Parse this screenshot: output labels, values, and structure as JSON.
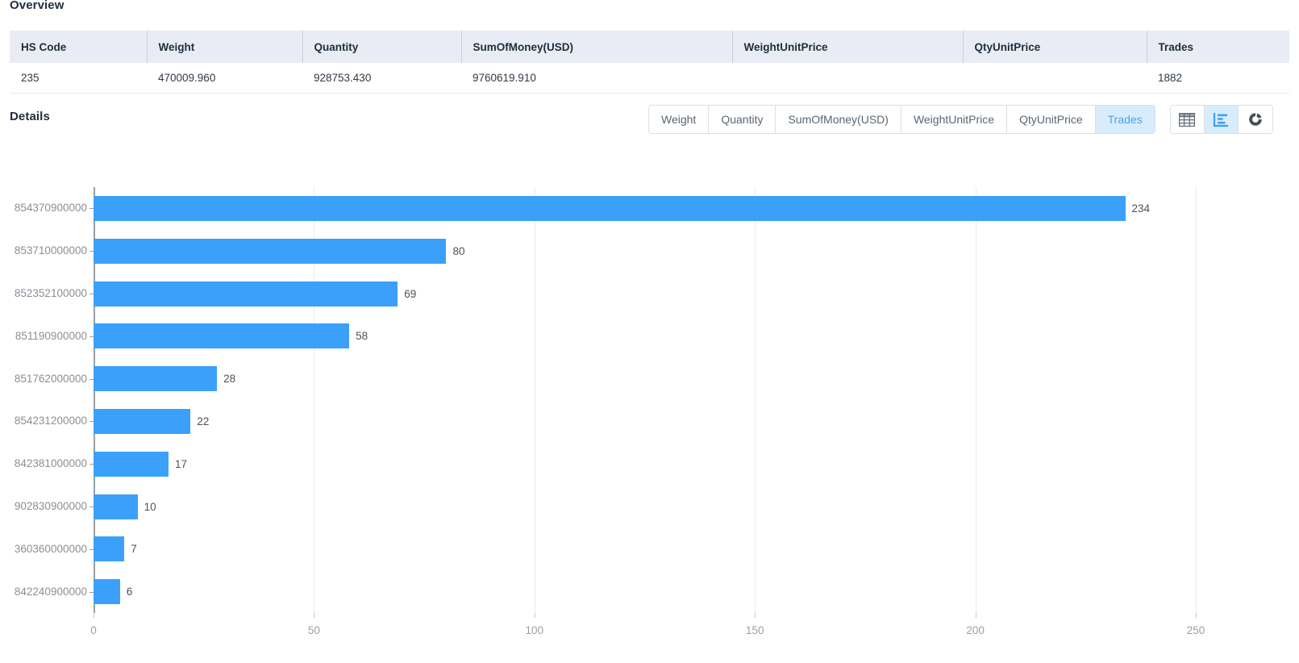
{
  "overview": {
    "title": "Overview",
    "columns": [
      {
        "key": "hs_code",
        "label": "HS Code"
      },
      {
        "key": "weight",
        "label": "Weight"
      },
      {
        "key": "quantity",
        "label": "Quantity"
      },
      {
        "key": "sum_of_money",
        "label": "SumOfMoney(USD)"
      },
      {
        "key": "weight_unit_price",
        "label": "WeightUnitPrice"
      },
      {
        "key": "qty_unit_price",
        "label": "QtyUnitPrice"
      },
      {
        "key": "trades",
        "label": "Trades"
      }
    ],
    "row": {
      "hs_code": "235",
      "weight": "470009.960",
      "quantity": "928753.430",
      "sum_of_money": "9760619.910",
      "weight_unit_price": "",
      "qty_unit_price": "",
      "trades": "1882"
    }
  },
  "details": {
    "title": "Details",
    "tabs": [
      {
        "label": "Weight",
        "active": false
      },
      {
        "label": "Quantity",
        "active": false
      },
      {
        "label": "SumOfMoney(USD)",
        "active": false
      },
      {
        "label": "WeightUnitPrice",
        "active": false
      },
      {
        "label": "QtyUnitPrice",
        "active": false
      },
      {
        "label": "Trades",
        "active": true
      }
    ],
    "view_icons": [
      {
        "name": "table-view-icon",
        "active": false
      },
      {
        "name": "bar-chart-view-icon",
        "active": true
      },
      {
        "name": "donut-chart-view-icon",
        "active": false
      }
    ]
  },
  "colors": {
    "bar": "#3ba0fa",
    "tab_active_bg": "#d9ecfb",
    "tab_active_text": "#4aa3e8",
    "table_header_bg": "#e9ecf5",
    "gridline": "#eaecf2",
    "axis": "#9aa0a6"
  },
  "chart_data": {
    "type": "bar",
    "orientation": "horizontal",
    "title": "",
    "xlabel": "",
    "ylabel": "",
    "categories": [
      "854370900000",
      "853710000000",
      "852352100000",
      "851190900000",
      "851762000000",
      "854231200000",
      "842381000000",
      "902830900000",
      "360360000000",
      "842240900000"
    ],
    "values": [
      234,
      80,
      69,
      58,
      28,
      22,
      17,
      10,
      7,
      6
    ],
    "value_labels": [
      "234",
      "80",
      "69",
      "58",
      "28",
      "22",
      "17",
      "10",
      "7",
      "6"
    ],
    "xticks": [
      0,
      50,
      100,
      150,
      200,
      250
    ],
    "xtick_labels": [
      "0",
      "50",
      "100",
      "150",
      "200",
      "250"
    ],
    "xlim": [
      0,
      250
    ],
    "grid": true,
    "legend": false
  }
}
